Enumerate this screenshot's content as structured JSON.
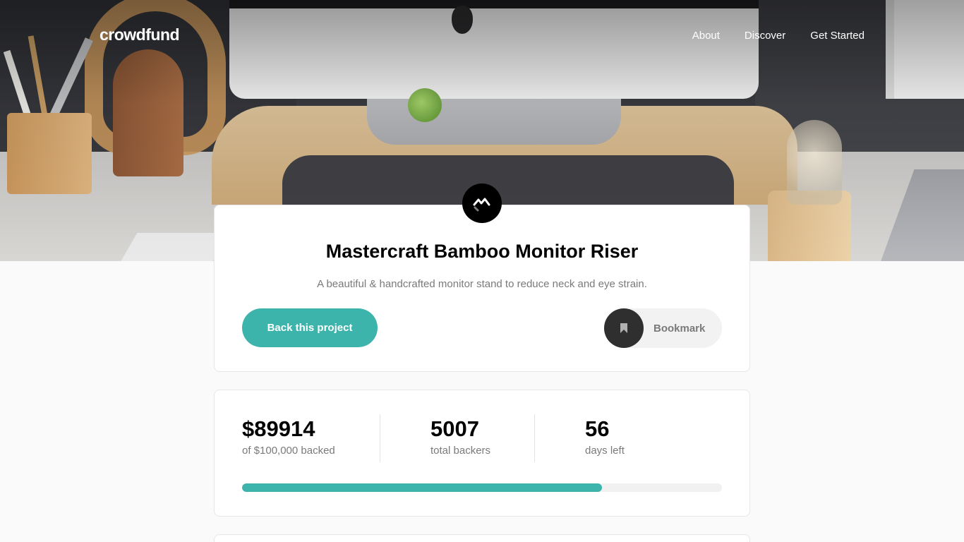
{
  "nav": {
    "logo": "crowdfund",
    "links": [
      "About",
      "Discover",
      "Get Started"
    ]
  },
  "project": {
    "title": "Mastercraft Bamboo Monitor Riser",
    "description": "A beautiful & handcrafted monitor stand to reduce neck and eye strain.",
    "back_label": "Back this project",
    "bookmark_label": "Bookmark",
    "logo_icon": "mastercraft-logo-icon",
    "bookmark_icon": "bookmark-icon"
  },
  "stats": {
    "backed_amount": "$89914",
    "backed_label": "of $100,000 backed",
    "total_backers": "5007",
    "backers_label": "total backers",
    "days_left": "56",
    "days_label": "days left",
    "progress": 0.75
  },
  "colors": {
    "accent": "#3cb4ac",
    "dark": "#2f2f2f",
    "muted_text": "#7a7a7a",
    "background": "#fafafa"
  }
}
